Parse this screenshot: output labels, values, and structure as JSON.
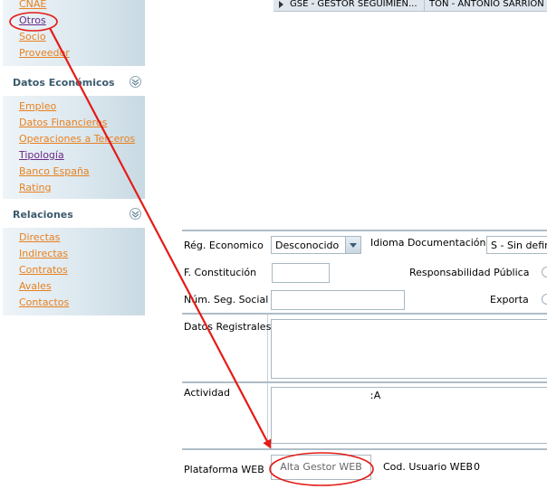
{
  "nav": {
    "other_links": [
      {
        "label": "CNAE"
      },
      {
        "label": "Otros"
      },
      {
        "label": "Socio"
      },
      {
        "label": "Proveedor"
      }
    ],
    "economic": {
      "title": "Datos Económicos",
      "links": [
        {
          "label": "Empleo"
        },
        {
          "label": "Datos Financieros"
        },
        {
          "label": "Operaciones a Terceros"
        },
        {
          "label": "Tipología"
        },
        {
          "label": "Banco España"
        },
        {
          "label": "Rating"
        }
      ]
    },
    "relations": {
      "title": "Relaciones",
      "links": [
        {
          "label": "Directas"
        },
        {
          "label": "Indirectas"
        },
        {
          "label": "Contratos"
        },
        {
          "label": "Avales"
        },
        {
          "label": "Contactos"
        }
      ]
    }
  },
  "grid": {
    "row": {
      "col1": "GSE - GESTOR SEGUIMIEN...",
      "col2": "TON - ANTONIO SARRION"
    }
  },
  "form": {
    "reg_economico": {
      "label": "Rég. Economico",
      "value": "Desconocido"
    },
    "idioma": {
      "label": "Idioma Documentación",
      "value": "S - Sin defini"
    },
    "f_constitucion": {
      "label": "F. Constitución",
      "value": ""
    },
    "resp_publica": {
      "label": "Responsabilidad Pública"
    },
    "num_seg_social": {
      "label": "Núm. Seg. Social",
      "value": ""
    },
    "exporta": {
      "label": "Exporta"
    },
    "datos_registrales": {
      "label": "Datos Registrales",
      "value": ""
    },
    "actividad": {
      "label": "Actividad",
      "value": "ːA"
    },
    "plataforma_web": {
      "label": "Plataforma WEB",
      "button": "Alta Gestor WEB"
    },
    "cod_usuario_web": {
      "label": "Cod. Usuario WEB",
      "value": "0"
    }
  },
  "colors": {
    "annotation": "#e41b17",
    "link": "#e8801f",
    "link_visited": "#6a2a86",
    "nav_gradient_end": "#c8d9e3"
  }
}
